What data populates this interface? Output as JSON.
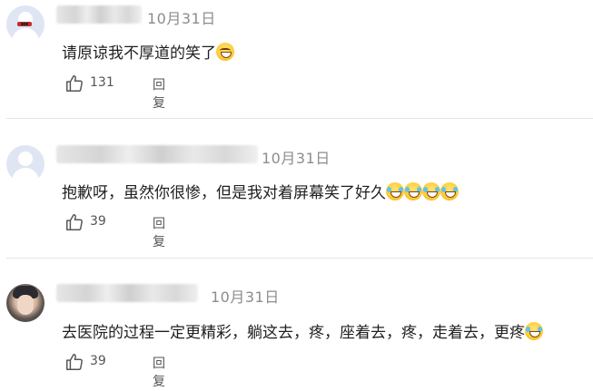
{
  "comments": [
    {
      "date": "10月31日",
      "text": "请原谅我不厚道的笑了",
      "emojis": [
        "smile"
      ],
      "likes": "131",
      "reply_label": "回复"
    },
    {
      "date": "10月31日",
      "text": "抱歉呀，虽然你很惨，但是我对着屏幕笑了好久",
      "emojis": [
        "laugh",
        "laugh",
        "laugh",
        "laugh"
      ],
      "likes": "39",
      "reply_label": "回复"
    },
    {
      "date": "10月31日",
      "text": "去医院的过程一定更精彩，躺这去，疼，座着去，疼，走着去，更疼",
      "emojis": [
        "laugh"
      ],
      "likes": "39",
      "reply_label": "回复"
    }
  ],
  "icons": {
    "like": "thumbs-up-icon",
    "emoji_smile": "smile-emoji-icon",
    "emoji_laugh": "laugh-tears-emoji-icon"
  }
}
